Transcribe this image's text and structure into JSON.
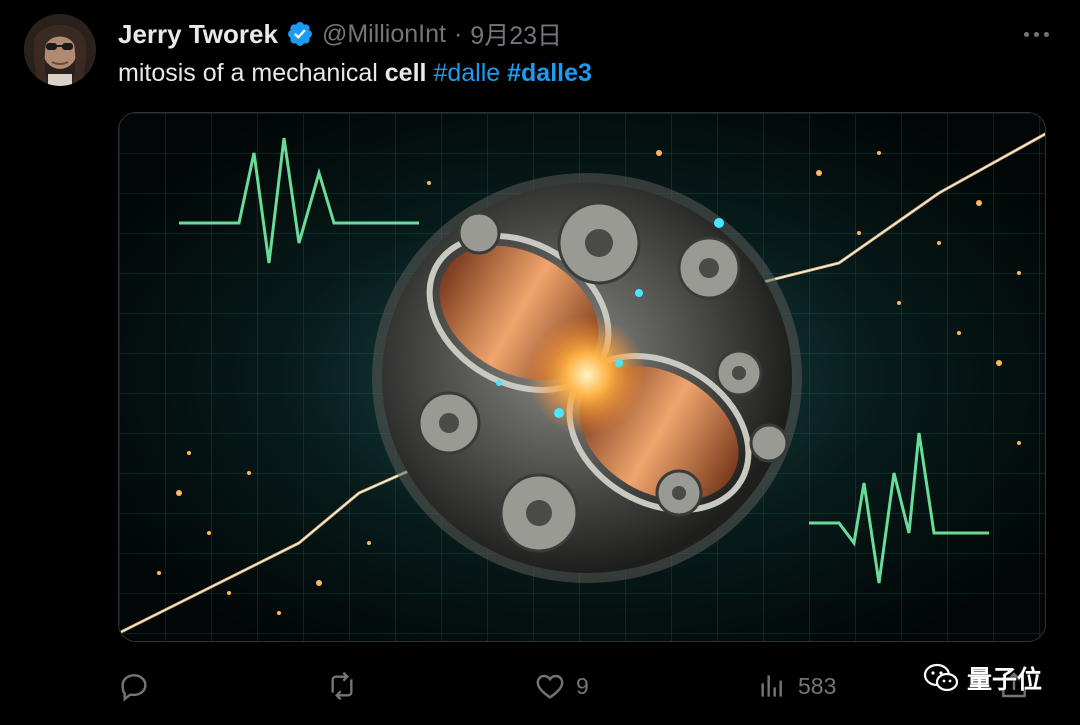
{
  "author": {
    "name": "Jerry Tworek",
    "handle": "@MillionInt",
    "separator": "·",
    "date": "9月23日",
    "verified_color": "#1d9bf0"
  },
  "tweet": {
    "text_parts": [
      {
        "text": "mitosis of a mechanical ",
        "style": "normal"
      },
      {
        "text": "cell",
        "style": "bold"
      },
      {
        "text": " ",
        "style": "normal"
      },
      {
        "text": "#dalle",
        "style": "hashtag"
      },
      {
        "text": " ",
        "style": "normal"
      },
      {
        "text": "#dalle3",
        "style": "hashtag-bold"
      }
    ],
    "link_color": "#1d9bf0"
  },
  "media": {
    "icon": "mechanical-cell-mitosis-image"
  },
  "actions": {
    "reply": {
      "icon": "reply-icon",
      "count": ""
    },
    "retweet": {
      "icon": "retweet-icon",
      "count": ""
    },
    "like": {
      "icon": "heart-icon",
      "count": "9"
    },
    "views": {
      "icon": "views-icon",
      "count": "583"
    },
    "share": {
      "icon": "share-icon"
    }
  },
  "watermark": {
    "text": "量子位",
    "icon": "wechat-icon"
  }
}
